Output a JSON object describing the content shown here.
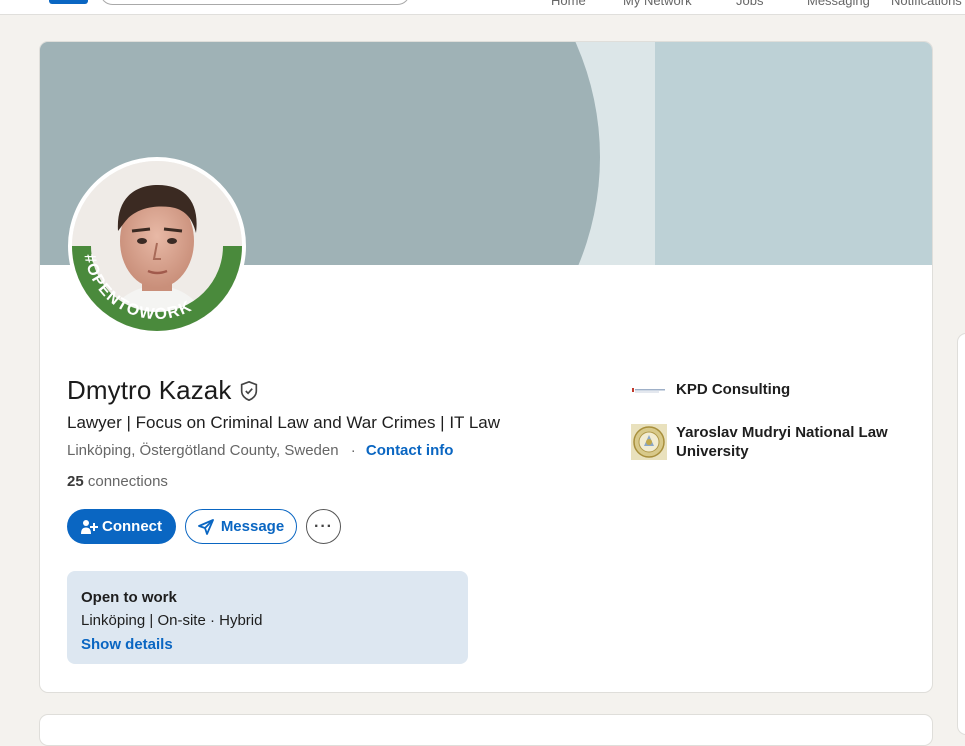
{
  "nav": {
    "items": [
      {
        "label": "Home"
      },
      {
        "label": "My Network"
      },
      {
        "label": "Jobs"
      },
      {
        "label": "Messaging"
      },
      {
        "label": "Notifications"
      }
    ]
  },
  "profile": {
    "name": "Dmytro Kazak",
    "headline": "Lawyer | Focus on Criminal Law and War Crimes | IT Law",
    "location": "Linköping, Östergötland County, Sweden",
    "contact_separator": "·",
    "contact_label": "Contact info",
    "connections_count": "25",
    "connections_label": "connections",
    "badge_text": "#OPENTOWORK"
  },
  "actions": {
    "connect_label": "Connect",
    "message_label": "Message",
    "more_label": "···"
  },
  "open_to_work": {
    "title": "Open to work",
    "detail": "Linköping | On-site · Hybrid",
    "link": "Show details"
  },
  "organizations": [
    {
      "name": "KPD Consulting",
      "icon": "kpd-logo-icon"
    },
    {
      "name": "Yaroslav Mudryi National Law University",
      "icon": "university-seal-icon"
    }
  ],
  "colors": {
    "accent": "#0a66c2",
    "open_to_work_green": "#4a8a3c",
    "page_bg": "#f4f2ee",
    "cover_primary": "#9fb2b6",
    "cover_secondary": "#bdd1d6"
  }
}
